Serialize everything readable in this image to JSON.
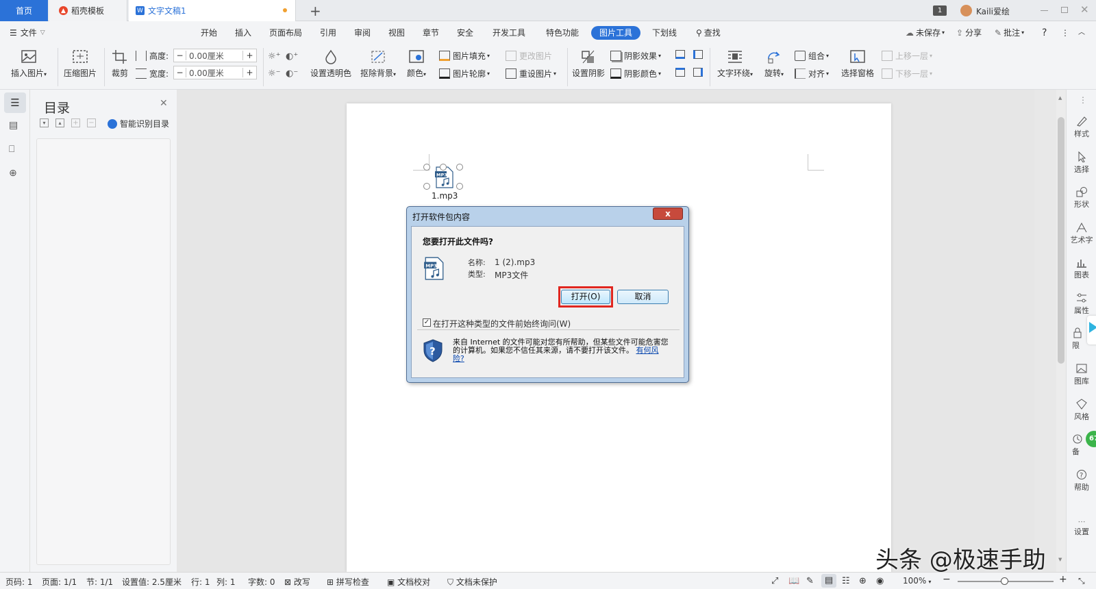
{
  "tabs": {
    "home": "首页",
    "daoke": "稻壳模板",
    "doc": "文字文稿1",
    "new_tab": "+"
  },
  "titlebar": {
    "page_badge": "1",
    "user": "Kaili爱绘"
  },
  "menu": {
    "file": "文件",
    "items": [
      "开始",
      "插入",
      "页面布局",
      "引用",
      "审阅",
      "视图",
      "章节",
      "安全",
      "开发工具",
      "特色功能",
      "图片工具",
      "下划线"
    ],
    "search": "查找",
    "unsaved": "未保存",
    "share": "分享",
    "comment": "批注",
    "help": "?"
  },
  "ribbon": {
    "insert_picture": "插入图片",
    "compress_picture": "压缩图片",
    "crop": "裁剪",
    "height_label": "高度:",
    "height_value": "0.00厘米",
    "width_label": "宽度:",
    "width_value": "0.00厘米",
    "set_transparent": "设置透明色",
    "remove_bg": "抠除背景",
    "color": "颜色",
    "picture_fill": "图片填充",
    "picture_outline": "图片轮廓",
    "change_picture": "更改图片",
    "reset_picture": "重设图片",
    "set_shadow": "设置阴影",
    "shadow_effect": "阴影效果",
    "shadow_color": "阴影颜色",
    "text_wrap": "文字环绕",
    "rotate": "旋转",
    "group": "组合",
    "align": "对齐",
    "selection_pane": "选择窗格",
    "bring_forward": "上移一层",
    "send_backward": "下移一层"
  },
  "nav": {
    "title": "目录",
    "smart": "智能识别目录"
  },
  "document": {
    "icon_label": "1.mp3"
  },
  "dialog": {
    "title": "打开软件包内容",
    "close": "x",
    "question": "您要打开此文件吗?",
    "name_label": "名称:",
    "name_value": "1 (2).mp3",
    "type_label": "类型:",
    "type_value": "MP3文件",
    "open_button": "打开(O)",
    "cancel_button": "取消",
    "checkbox_label": "在打开这种类型的文件前始终询问(W)",
    "checkbox_checked": true,
    "warning_text": "来自 Internet 的文件可能对您有所帮助，但某些文件可能危害您的计算机。如果您不信任其来源，请不要打开该文件。",
    "warning_link": "有何风险?"
  },
  "right_panel": [
    "样式",
    "选择",
    "形状",
    "艺术字",
    "图表",
    "属性",
    "限",
    "图库",
    "风格",
    "备",
    "帮助",
    "设置"
  ],
  "right_badge": "67",
  "status": {
    "page_code": "页码: 1",
    "pages": "页面: 1/1",
    "section": "节: 1/1",
    "setting": "设置值: 2.5厘米",
    "row": "行: 1",
    "col": "列: 1",
    "words": "字数: 0",
    "revise": "改写",
    "spell": "拼写检查",
    "proof": "文档校对",
    "protect": "文档未保护",
    "zoom": "100%"
  },
  "watermark": "头条 @极速手助",
  "colors": {
    "accent": "#2b72d8",
    "highlight_border": "#e0261f",
    "daoke_icon": "#e8462b",
    "badge": "#3bb44a"
  }
}
